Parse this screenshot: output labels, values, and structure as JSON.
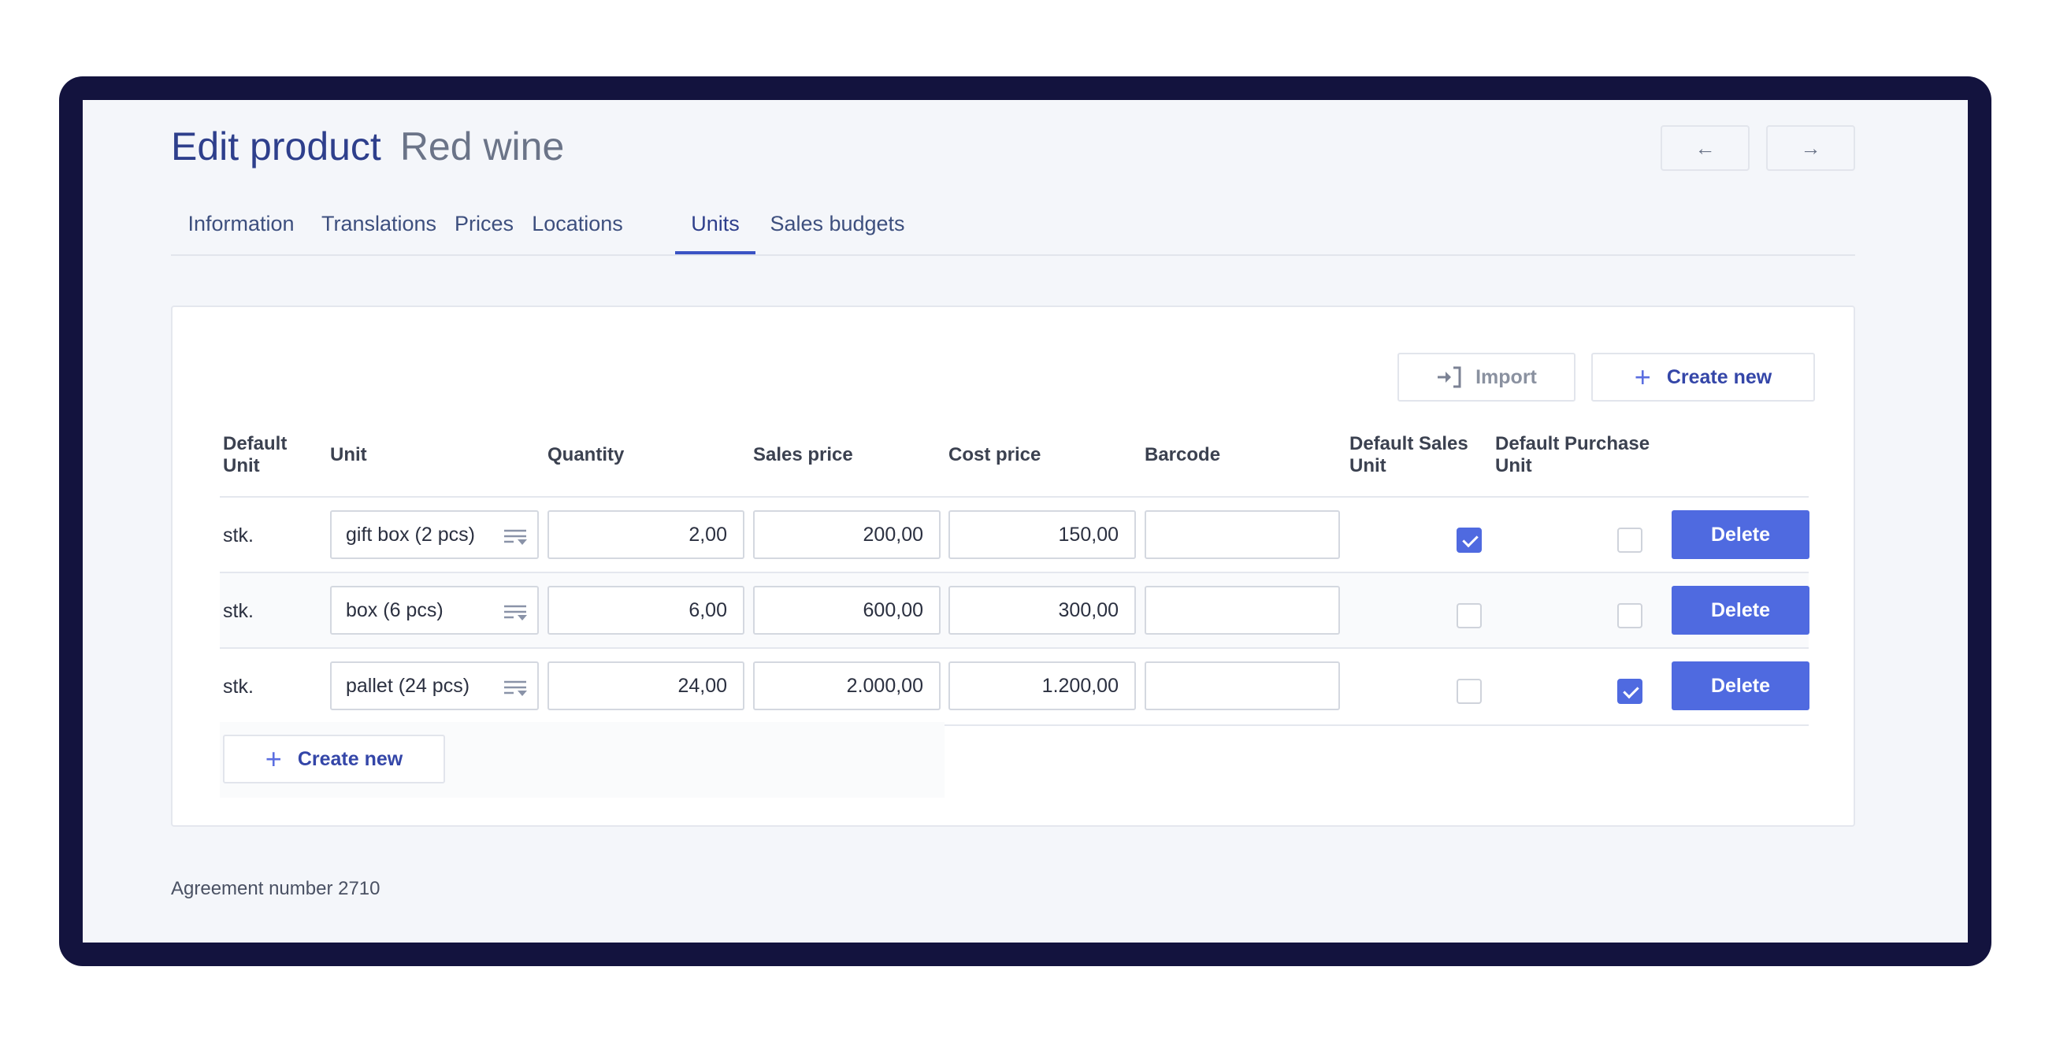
{
  "header": {
    "title": "Edit product",
    "subtitle": "Red wine",
    "prev_icon": "←",
    "next_icon": "→"
  },
  "tabs": [
    {
      "label": "Information",
      "active": false
    },
    {
      "label": "Translations",
      "active": false
    },
    {
      "label": "Prices",
      "active": false
    },
    {
      "label": "Locations",
      "active": false
    },
    {
      "label": "Units",
      "active": true
    },
    {
      "label": "Sales budgets",
      "active": false
    }
  ],
  "toolbar": {
    "import_label": "Import",
    "import_icon": "import-icon",
    "create_label": "Create new",
    "create_icon": "plus-icon"
  },
  "table": {
    "columns": {
      "default_unit": "Default Unit",
      "unit": "Unit",
      "quantity": "Quantity",
      "sales_price": "Sales price",
      "cost_price": "Cost price",
      "barcode": "Barcode",
      "default_sales_unit": "Default Sales Unit",
      "default_purchase_unit": "Default Purchase Unit"
    },
    "rows": [
      {
        "default_unit": "stk.",
        "unit": "gift box (2 pcs)",
        "quantity": "2,00",
        "sales_price": "200,00",
        "cost_price": "150,00",
        "barcode": "",
        "default_sales": true,
        "default_purchase": false,
        "delete_label": "Delete"
      },
      {
        "default_unit": "stk.",
        "unit": "box (6 pcs)",
        "quantity": "6,00",
        "sales_price": "600,00",
        "cost_price": "300,00",
        "barcode": "",
        "default_sales": false,
        "default_purchase": false,
        "delete_label": "Delete"
      },
      {
        "default_unit": "stk.",
        "unit": "pallet (24 pcs)",
        "quantity": "24,00",
        "sales_price": "2.000,00",
        "cost_price": "1.200,00",
        "barcode": "",
        "default_sales": false,
        "default_purchase": true,
        "delete_label": "Delete"
      }
    ],
    "create_label": "Create new"
  },
  "footer": {
    "agreement": "Agreement number 2710"
  },
  "colors": {
    "frame": "#13133e",
    "accent": "#4f6ae0",
    "title": "#2e3f8c",
    "background": "#f4f6fa"
  }
}
